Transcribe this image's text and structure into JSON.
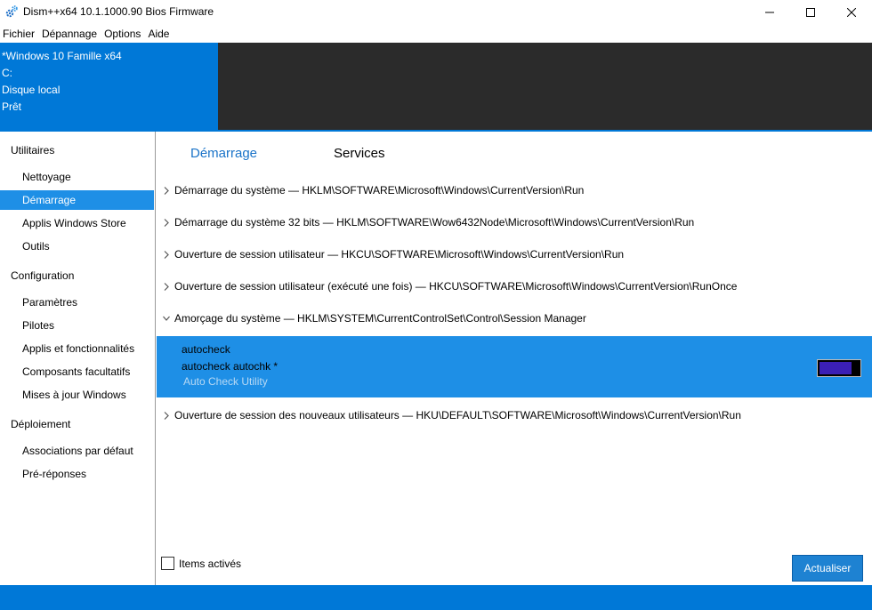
{
  "window": {
    "title": "Dism++x64 10.1.1000.90 Bios Firmware",
    "icon": "gears-icon"
  },
  "menu": [
    "Fichier",
    "Dépannage",
    "Options",
    "Aide"
  ],
  "header": {
    "lines": [
      "*Windows 10 Famille x64",
      "C:",
      "Disque local",
      "Prêt"
    ]
  },
  "sidebar": {
    "categories": [
      {
        "label": "Utilitaires",
        "items": [
          "Nettoyage",
          "Démarrage",
          "Applis Windows Store",
          "Outils"
        ]
      },
      {
        "label": "Configuration",
        "items": [
          "Paramètres",
          "Pilotes",
          "Applis et fonctionnalités",
          "Composants facultatifs",
          "Mises à jour Windows"
        ]
      },
      {
        "label": "Déploiement",
        "items": [
          "Associations par défaut",
          "Pré-réponses"
        ]
      }
    ],
    "active_item": "Démarrage"
  },
  "tabs": [
    {
      "label": "Démarrage",
      "active": true
    },
    {
      "label": "Services",
      "active": false
    }
  ],
  "startup_groups": [
    {
      "label": "Démarrage du système — HKLM\\SOFTWARE\\Microsoft\\Windows\\CurrentVersion\\Run",
      "expanded": false
    },
    {
      "label": "Démarrage du système 32 bits — HKLM\\SOFTWARE\\Wow6432Node\\Microsoft\\Windows\\CurrentVersion\\Run",
      "expanded": false
    },
    {
      "label": "Ouverture de session utilisateur — HKCU\\SOFTWARE\\Microsoft\\Windows\\CurrentVersion\\Run",
      "expanded": false
    },
    {
      "label": "Ouverture de session utilisateur (exécuté une fois) — HKCU\\SOFTWARE\\Microsoft\\Windows\\CurrentVersion\\RunOnce",
      "expanded": false
    },
    {
      "label": "Amorçage du système — HKLM\\SYSTEM\\CurrentControlSet\\Control\\Session Manager",
      "expanded": true
    },
    {
      "label": "Ouverture de session des nouveaux utilisateurs — HKU\\DEFAULT\\SOFTWARE\\Microsoft\\Windows\\CurrentVersion\\Run",
      "expanded": false
    }
  ],
  "selected_entry": {
    "name": "autocheck",
    "command": "autocheck autochk *",
    "description": "Auto Check Utility",
    "enabled": true
  },
  "footer": {
    "checkbox_label": "Items activés",
    "checkbox_checked": false,
    "refresh_label": "Actualiser"
  },
  "colors": {
    "accent": "#0078d7",
    "selection": "#1e8fe6",
    "toggle_on": "#3b1fb5",
    "header_dark": "#2b2b2b"
  }
}
